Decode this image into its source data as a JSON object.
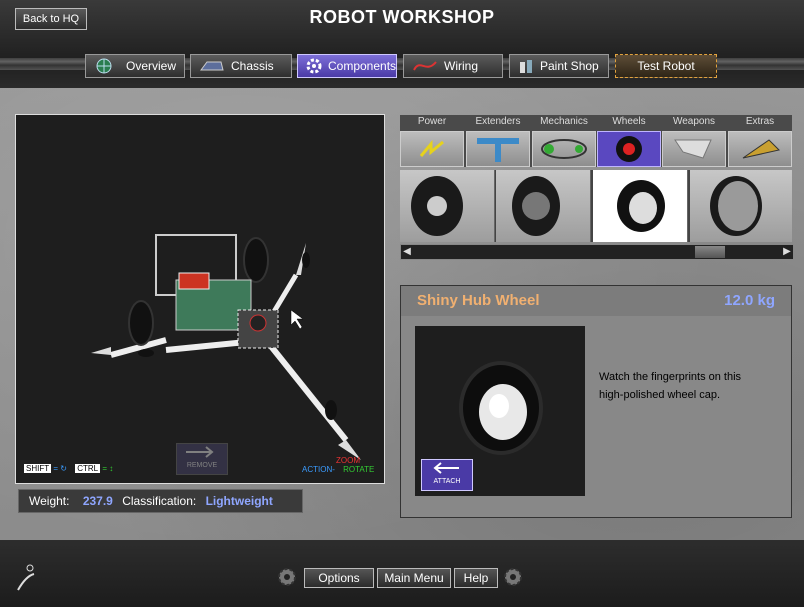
{
  "header": {
    "back_label": "Back to HQ",
    "title": "ROBOT WORKSHOP"
  },
  "tabs": [
    {
      "label": "Overview",
      "icon": "globe-icon"
    },
    {
      "label": "Chassis",
      "icon": "chassis-icon"
    },
    {
      "label": "Components",
      "icon": "gear-icon",
      "active": true
    },
    {
      "label": "Wiring",
      "icon": "wire-icon"
    },
    {
      "label": "Paint Shop",
      "icon": "paint-icon"
    },
    {
      "label": "Test Robot",
      "icon": "test-icon"
    }
  ],
  "viewport": {
    "remove_label": "REMOVE",
    "shift_label": "SHIFT",
    "ctrl_label": "CTRL",
    "action_label": "ACTION-",
    "zoom_label": "ZOOM",
    "rotate_label": "ROTATE"
  },
  "stats": {
    "weight_label": "Weight:",
    "weight_value": "237.9",
    "class_label": "Classification:",
    "class_value": "Lightweight"
  },
  "categories": [
    {
      "label": "Power"
    },
    {
      "label": "Extenders"
    },
    {
      "label": "Mechanics"
    },
    {
      "label": "Wheels",
      "active": true
    },
    {
      "label": "Weapons"
    },
    {
      "label": "Extras"
    }
  ],
  "part": {
    "name": "Shiny Hub Wheel",
    "weight": "12.0 kg",
    "description_line1": "Watch the fingerprints on this",
    "description_line2": "high-polished wheel cap.",
    "attach_label": "ATTACH"
  },
  "footer": {
    "options": "Options",
    "main_menu": "Main Menu",
    "help": "Help"
  },
  "colors": {
    "accent": "#5a48c0",
    "part_name": "#f0b071",
    "value": "#8fa6ff"
  }
}
